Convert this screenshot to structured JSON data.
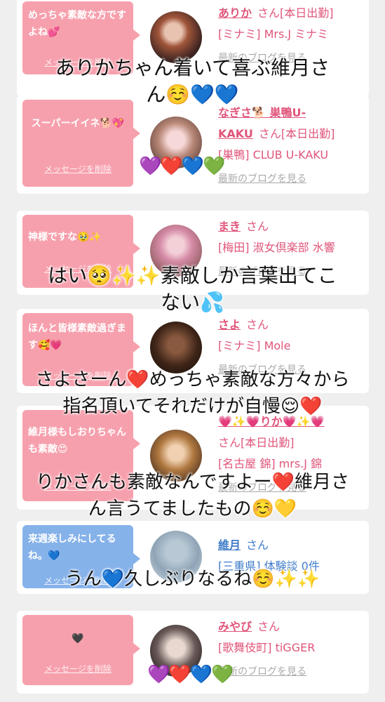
{
  "cards": [
    {
      "bubble": "めっちゃ素敵な方ですよね💕",
      "delete": "メッセージを削除",
      "name": "ありか",
      "san": "さん[本日出勤]",
      "line1": "[ミナミ] Mrs.J ミナミ",
      "blog": "最新のブログを見る"
    },
    {
      "bubble": "スーパーイイネ🐕💖",
      "delete": "メッセージを削除",
      "name": "なぎさ🐕巣鴨U-KAKU",
      "name_line1": "なぎさ🐕 巣鴨U-",
      "name_line2": "KAKU",
      "san": "さん[本日出勤]",
      "line1": "[巣鴨] CLUB U-KAKU",
      "blog": "最新のブログを見る"
    },
    {
      "bubble": "神様ですな🥹✨",
      "delete": "メッセージを削除",
      "name": "まき",
      "san": "さん",
      "line1": "[梅田] 淑女倶楽部 水響",
      "blog": "最新のブログを見る"
    },
    {
      "bubble": "ほんと皆様素敵過ぎます🥰💗",
      "delete": "メッセージを削除",
      "name": "さよ",
      "san": "さん",
      "line1": "[ミナミ] Mole",
      "blog": "最新のブログを見る"
    },
    {
      "bubble": "維月様もしおりちゃんも素敵😍",
      "delete": "メッセージを削除",
      "name": "💗✨💗りか💗✨💗",
      "san": "さん[本日出勤]",
      "line1": "[名古屋 錦] mrs.J 錦",
      "blog": "最新のブログを見る"
    },
    {
      "bubble": "来週楽しみにしてるね。💙",
      "delete": "メッセージを削除",
      "name": "維月",
      "san": "さん",
      "line1": "[三重県] 体験談 0件"
    },
    {
      "bubble": "🖤",
      "delete": "メッセージを削除",
      "name": "みやび",
      "san": "さん",
      "line1": "[歌舞伎町] tiGGER",
      "blog": "最新のブログを見る"
    }
  ],
  "overlays": {
    "o1_l1": "ありかちゃん着いて喜ぶ維月さ",
    "o1_l2": "ん☺️💙💙",
    "o2_l1": "はい🥺✨✨素敵しか言葉出てこ",
    "o2_l2": "ない💦",
    "o3_l1": "さよさーん❤️めっちゃ素敵な方々から",
    "o3_l2": "指名頂いてそれだけが自慢😌❤️",
    "o4_l1": "りかさんも素敵なんですよー❤️維月さ",
    "o4_l2": "ん言うてましたもの☺️💛",
    "o5_l1": "うん💙久しぶりなるね☺️✨✨",
    "hearts_a": "💜❤️💙💚",
    "hearts_b": "💜❤️💙💚"
  },
  "colors": {
    "pink_bubble": "#f7a0ad",
    "blue_bubble": "#86b2ea",
    "name_pink": "#e0557a",
    "name_blue": "#3f7cc9"
  }
}
